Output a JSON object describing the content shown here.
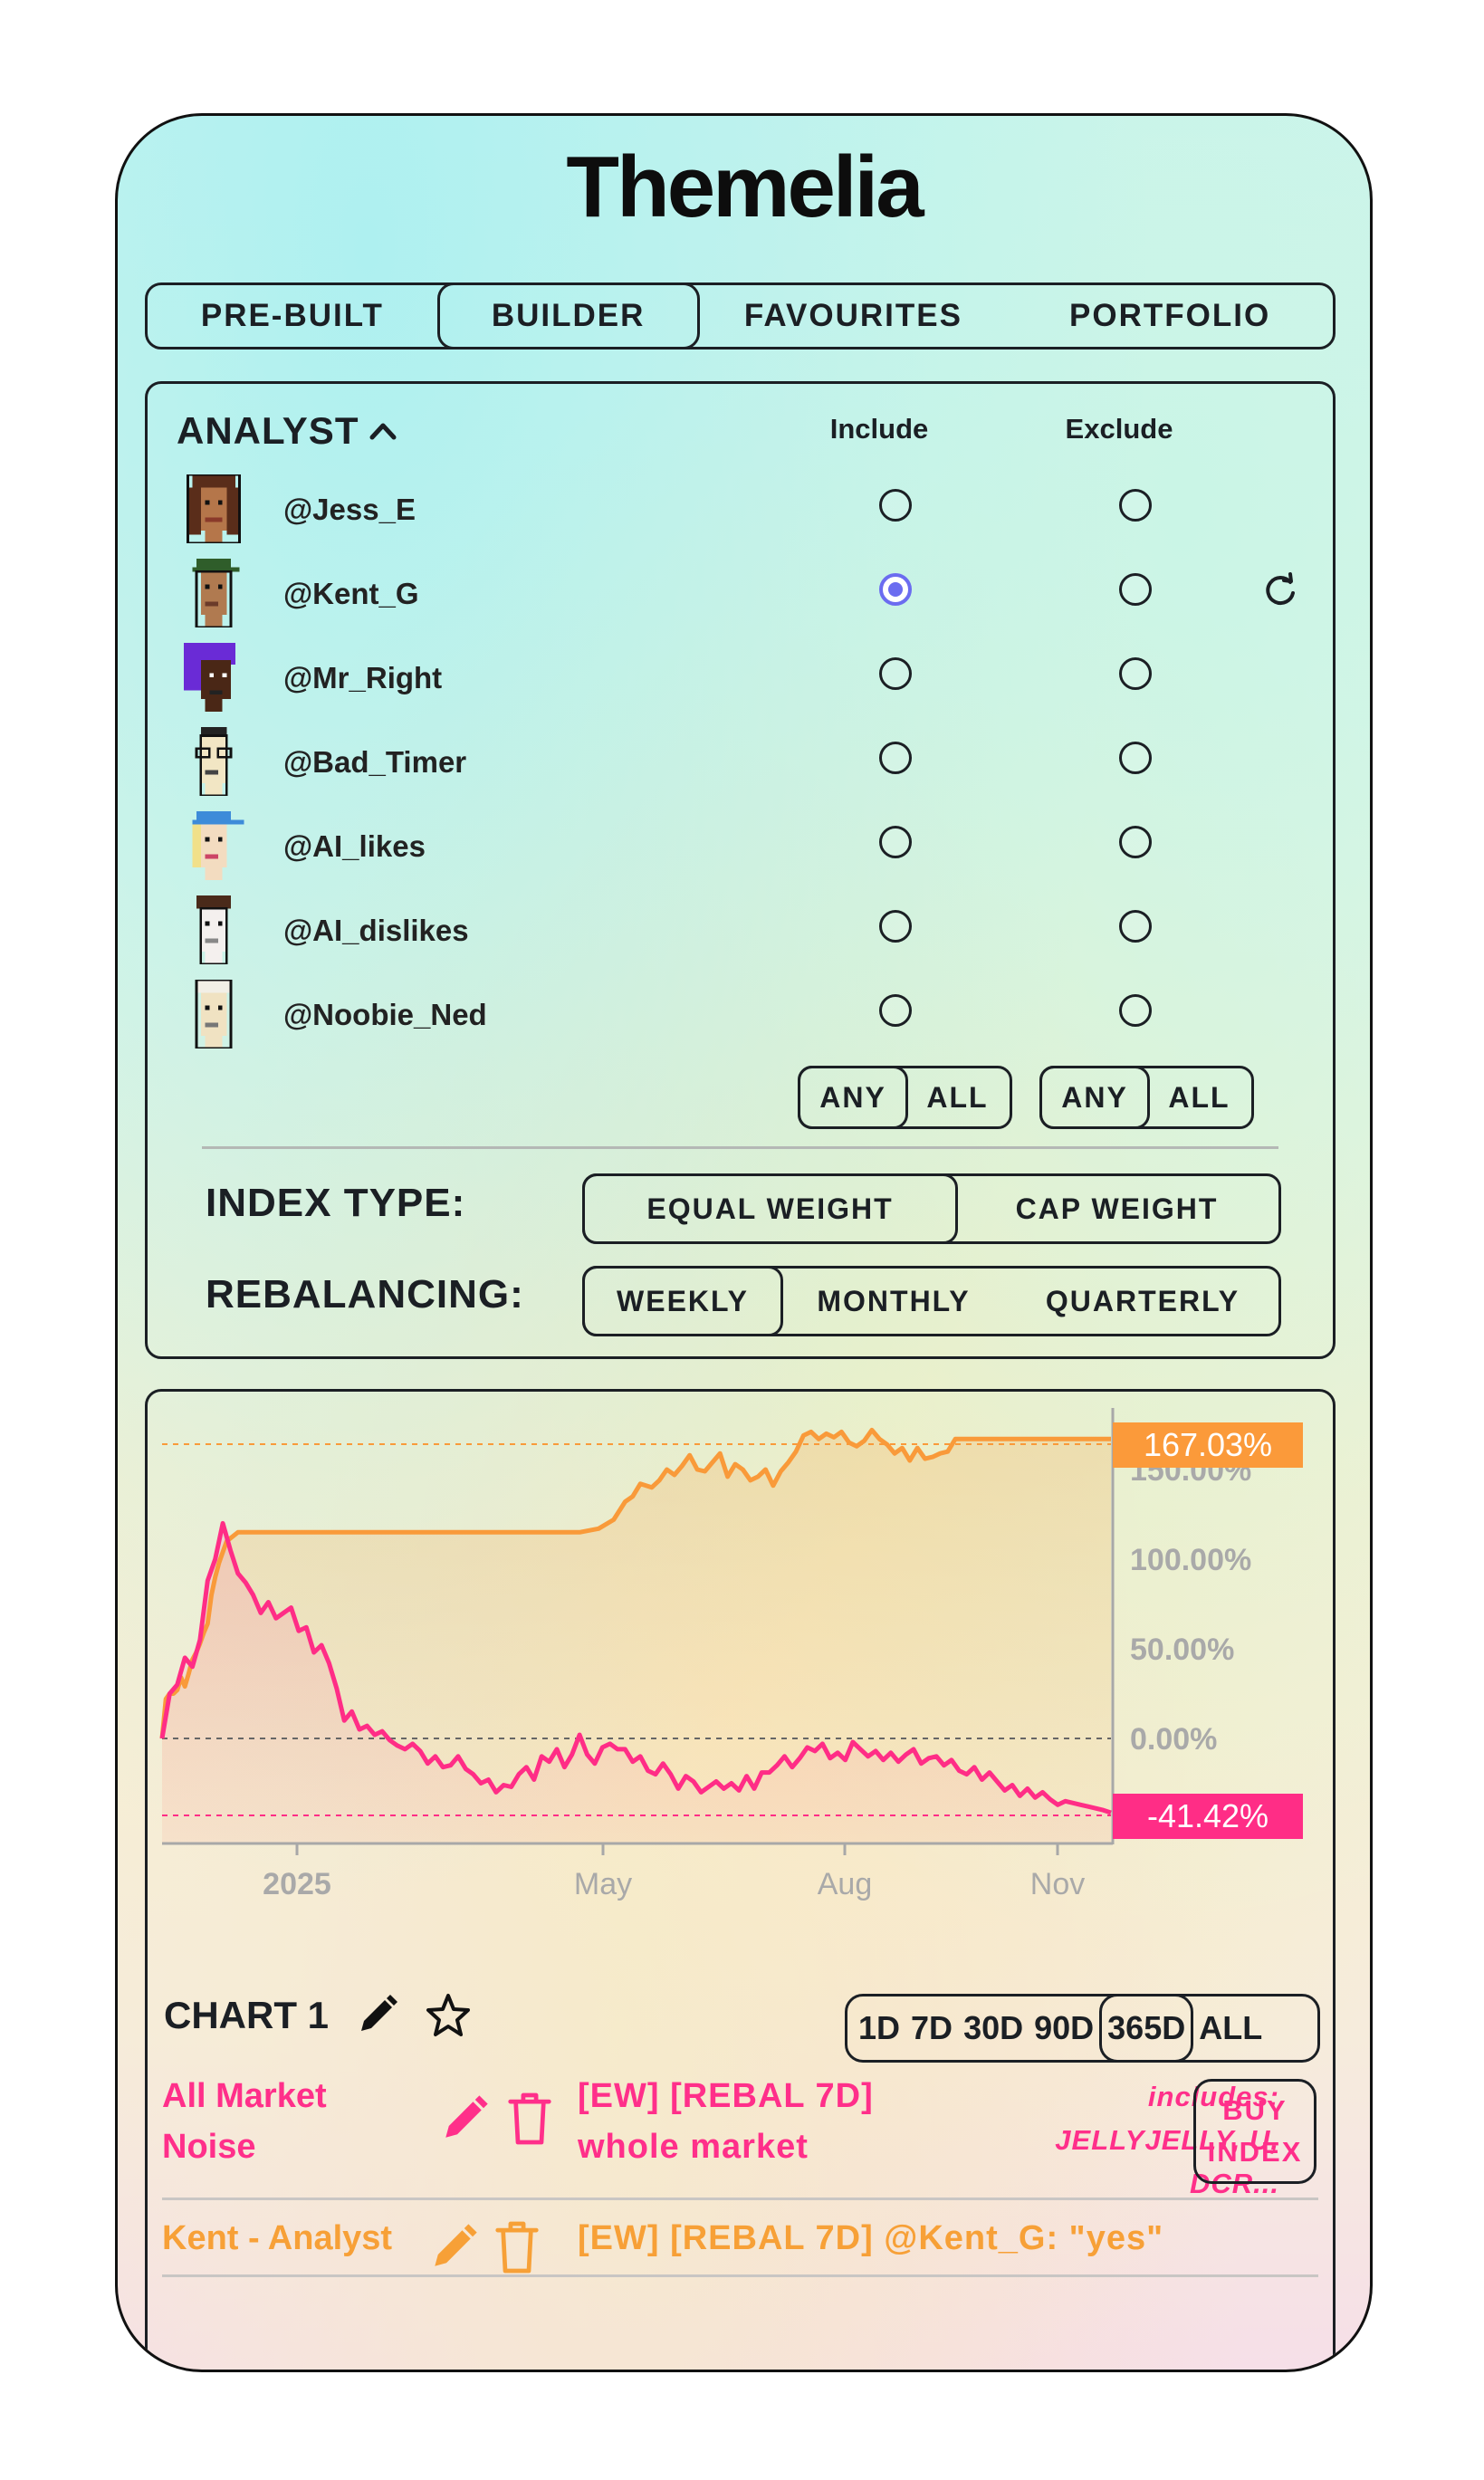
{
  "app": {
    "title": "Themelia"
  },
  "tabs": [
    {
      "label": "PRE-BUILT",
      "active": false
    },
    {
      "label": "BUILDER",
      "active": true
    },
    {
      "label": "FAVOURITES",
      "active": false
    },
    {
      "label": "PORTFOLIO",
      "active": false
    }
  ],
  "analyst": {
    "title": "ANALYST",
    "include_header": "Include",
    "exclude_header": "Exclude",
    "rows": [
      {
        "handle": "@Jess_E",
        "include": false,
        "exclude": false,
        "avatar": "brown-hair-woman"
      },
      {
        "handle": "@Kent_G",
        "include": true,
        "exclude": false,
        "avatar": "green-cap-man"
      },
      {
        "handle": "@Mr_Right",
        "include": false,
        "exclude": false,
        "avatar": "purple-hair-man"
      },
      {
        "handle": "@Bad_Timer",
        "include": false,
        "exclude": false,
        "avatar": "glasses-man"
      },
      {
        "handle": "@AI_likes",
        "include": false,
        "exclude": false,
        "avatar": "blue-cap-blonde"
      },
      {
        "handle": "@AI_dislikes",
        "include": false,
        "exclude": false,
        "avatar": "dark-hair-pale"
      },
      {
        "handle": "@Noobie_Ned",
        "include": false,
        "exclude": false,
        "avatar": "white-hair-man"
      }
    ],
    "include_mode": {
      "options": [
        "ANY",
        "ALL"
      ],
      "selected": "ANY"
    },
    "exclude_mode": {
      "options": [
        "ANY",
        "ALL"
      ],
      "selected": "ANY"
    }
  },
  "settings": {
    "index_type_label": "INDEX TYPE:",
    "index_type_options": [
      "EQUAL WEIGHT",
      "CAP WEIGHT"
    ],
    "index_type_selected": "EQUAL WEIGHT",
    "rebalancing_label": "REBALANCING:",
    "rebalancing_options": [
      "WEEKLY",
      "MONTHLY",
      "QUARTERLY"
    ],
    "rebalancing_selected": "WEEKLY"
  },
  "chart_data": {
    "type": "line",
    "x_tick_labels": [
      "2025",
      "May",
      "Aug",
      "Nov"
    ],
    "y_tick_labels": [
      "150.00%",
      "100.00%",
      "50.00%",
      "0.00%"
    ],
    "ylim": [
      -48,
      180
    ],
    "grid": false,
    "series": [
      {
        "name": "Kent - Analyst",
        "color": "#f99a3a",
        "last_value_label": "167.03%",
        "x": [
          0,
          2,
          4,
          6,
          8,
          10,
          12,
          14,
          16,
          18,
          20,
          22,
          24,
          26,
          28,
          30,
          34,
          40,
          50,
          60,
          70,
          80,
          90,
          100,
          120,
          140,
          160,
          180,
          200,
          220,
          230,
          238,
          244,
          248,
          252,
          258,
          262,
          266,
          270,
          274,
          278,
          282,
          286,
          290,
          294,
          298,
          302,
          306,
          310,
          314,
          318,
          322,
          326,
          330,
          334,
          338,
          342,
          346,
          350,
          354,
          358,
          362,
          366,
          370,
          374,
          378,
          382,
          386,
          390,
          394,
          398,
          402,
          406,
          410,
          414,
          418,
          422,
          426,
          430,
          434,
          438,
          442,
          446,
          450,
          460,
          470,
          480,
          490,
          500
        ],
        "y": [
          0,
          22,
          25,
          25,
          27,
          34,
          29,
          36,
          44,
          48,
          53,
          59,
          64,
          80,
          90,
          98,
          110,
          115,
          115,
          115,
          115,
          115,
          115,
          115,
          115,
          115,
          115,
          115,
          115,
          115,
          117,
          122,
          132,
          135,
          142,
          140,
          144,
          150,
          147,
          152,
          158,
          150,
          149,
          154,
          159,
          146,
          153,
          150,
          144,
          146,
          150,
          141,
          149,
          154,
          160,
          169,
          171,
          167,
          170,
          168,
          171,
          165,
          163,
          166,
          172,
          167,
          164,
          159,
          162,
          155,
          162,
          156,
          157,
          159,
          160,
          167,
          167,
          167,
          167,
          167,
          167,
          167,
          167,
          167,
          167,
          167,
          167,
          167,
          167.03
        ]
      },
      {
        "name": "All Market Noise",
        "color": "#ff2d86",
        "last_value_label": "-41.42%",
        "x": [
          0,
          4,
          8,
          12,
          16,
          20,
          24,
          28,
          32,
          36,
          40,
          44,
          48,
          52,
          56,
          60,
          64,
          68,
          72,
          76,
          80,
          84,
          88,
          92,
          96,
          100,
          104,
          108,
          112,
          116,
          120,
          124,
          128,
          132,
          136,
          140,
          144,
          148,
          152,
          156,
          160,
          164,
          168,
          172,
          176,
          180,
          184,
          188,
          192,
          196,
          200,
          204,
          208,
          212,
          216,
          220,
          224,
          228,
          232,
          236,
          240,
          244,
          248,
          252,
          256,
          260,
          264,
          268,
          272,
          276,
          280,
          284,
          288,
          292,
          296,
          300,
          304,
          308,
          312,
          316,
          320,
          324,
          328,
          332,
          336,
          340,
          344,
          348,
          352,
          356,
          360,
          364,
          368,
          372,
          376,
          380,
          384,
          388,
          392,
          396,
          400,
          404,
          408,
          412,
          416,
          420,
          424,
          428,
          432,
          436,
          440,
          444,
          448,
          452,
          456,
          460,
          464,
          468,
          472,
          476,
          480,
          484,
          488,
          492,
          496,
          500
        ],
        "y": [
          0,
          25,
          30,
          45,
          40,
          55,
          88,
          100,
          120,
          105,
          92,
          87,
          80,
          70,
          76,
          67,
          70,
          73,
          60,
          62,
          48,
          52,
          42,
          28,
          10,
          15,
          5,
          7,
          2,
          4,
          -1,
          -4,
          -6,
          -3,
          -7,
          -14,
          -10,
          -16,
          -15,
          -10,
          -17,
          -20,
          -25,
          -23,
          -30,
          -26,
          -27,
          -20,
          -16,
          -23,
          -10,
          -13,
          -6,
          -16,
          -9,
          2,
          -9,
          -14,
          -5,
          -3,
          -6,
          -6,
          -13,
          -10,
          -18,
          -20,
          -14,
          -20,
          -28,
          -21,
          -24,
          -30,
          -27,
          -24,
          -28,
          -25,
          -29,
          -21,
          -28,
          -19,
          -19,
          -15,
          -10,
          -16,
          -11,
          -5,
          -7,
          -3,
          -11,
          -8,
          -12,
          -2,
          -6,
          -10,
          -7,
          -12,
          -8,
          -13,
          -9,
          -6,
          -14,
          -11,
          -10,
          -15,
          -12,
          -18,
          -20,
          -16,
          -23,
          -19,
          -24,
          -29,
          -26,
          -32,
          -28,
          -33,
          -30,
          -34,
          -37,
          -35,
          -36,
          -37,
          -38,
          -39,
          -40,
          -41.42
        ]
      }
    ]
  },
  "chart_footer": {
    "title": "CHART 1",
    "ranges": [
      "1D",
      "7D",
      "30D",
      "90D",
      "365D",
      "ALL"
    ],
    "selected_range": "365D"
  },
  "indices": [
    {
      "name_line1": "All Market",
      "name_line2": "Noise",
      "desc_line1": "[EW] [REBAL 7D]",
      "desc_line2": "whole market",
      "includes_line1": "includes:",
      "includes_line2": "JELLYJELLY, U,",
      "includes_line3": "DCR...",
      "buy_line1": "BUY",
      "buy_line2": "INDEX",
      "color": "#ff2f8a"
    },
    {
      "name": "Kent - Analyst",
      "desc": "[EW] [REBAL 7D] @Kent_G: \"yes\"",
      "color": "#f7a037"
    }
  ]
}
